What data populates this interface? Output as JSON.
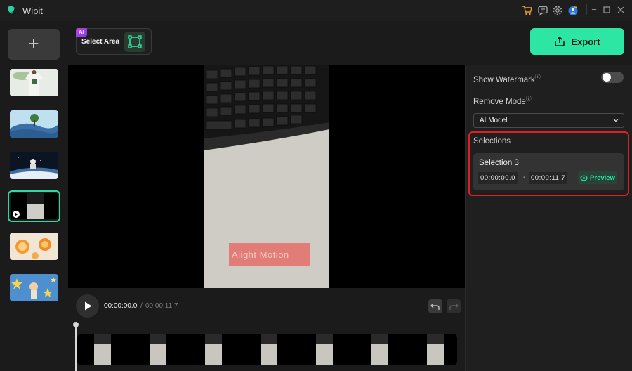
{
  "app": {
    "title": "Wipit"
  },
  "toolbar": {
    "ai_badge": "AI",
    "select_area_label": "Select Area",
    "export_label": "Export"
  },
  "sidebar": {
    "add_label": "+",
    "thumbnails": [
      {
        "name": "thumbnail-tshirt"
      },
      {
        "name": "thumbnail-landscape"
      },
      {
        "name": "thumbnail-astronaut"
      },
      {
        "name": "thumbnail-video-keyboard",
        "active": true
      },
      {
        "name": "thumbnail-oranges"
      },
      {
        "name": "thumbnail-stars"
      }
    ]
  },
  "player": {
    "current_time": "00:00:00.0",
    "separator": "/",
    "total_time": "00:00:11.7",
    "watermark_text": "Alight Motion"
  },
  "panel": {
    "show_watermark_label": "Show Watermark",
    "show_watermark_on": false,
    "remove_mode_label": "Remove Mode",
    "remove_mode_value": "AI Model",
    "selections_label": "Selections",
    "selection": {
      "name": "Selection 3",
      "start": "00:00:00.0",
      "dash": "-",
      "end": "00:00:11.7",
      "preview_label": "Preview"
    }
  },
  "colors": {
    "accent": "#2ee6a4",
    "highlight": "#e02020",
    "watermark": "#e76560"
  }
}
